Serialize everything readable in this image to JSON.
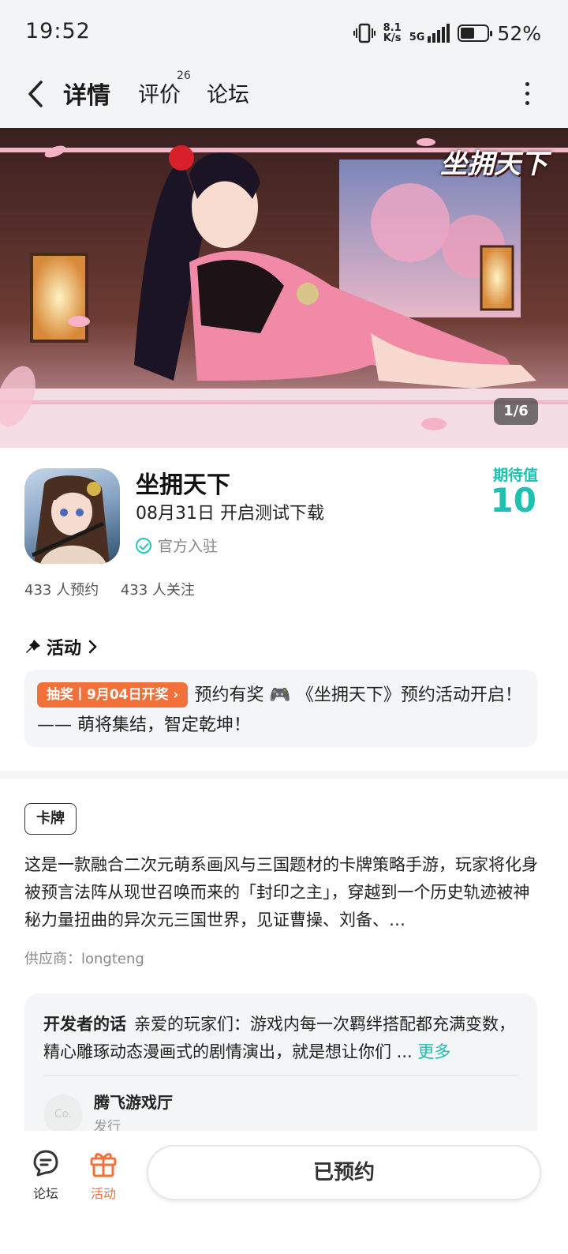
{
  "status_bar": {
    "time": "19:52",
    "net_speed_top": "8.1",
    "net_speed_bottom": "K/s",
    "network": "5G",
    "battery_percent": "52%",
    "battery_level": 0.52
  },
  "nav": {
    "tabs": [
      {
        "label": "详情",
        "active": true
      },
      {
        "label": "评价",
        "badge": "26"
      },
      {
        "label": "论坛"
      }
    ],
    "back_icon": "chevron-left-icon",
    "more_icon": "more-vertical-icon",
    "accent_color": "#25c7b9"
  },
  "banner": {
    "logo_text": "坐拥天下",
    "counter": "1/6"
  },
  "app": {
    "name": "坐拥天下",
    "release": "08月31日 开启测试下载",
    "official": "官方入驻",
    "expect_label": "期待值",
    "expect_value": "10",
    "reservations": "433 人预约",
    "follows": "433 人关注"
  },
  "activity": {
    "heading": "活动",
    "badge": "抽奖丨9月04日开奖",
    "text": "预约有奖 🎮 《坐拥天下》预约活动开启！—— 萌将集结，智定乾坤！"
  },
  "detail": {
    "tag": "卡牌",
    "description": "这是一款融合二次元萌系画风与三国题材的卡牌策略手游，玩家将化身被预言法阵从现世召唤而来的「封印之主」，穿越到一个历史轨迹被神秘力量扭曲的异次元三国世界，见证曹操、刘备、…",
    "supplier": "供应商：longteng"
  },
  "developer": {
    "title": "开发者的话",
    "text": "亲爱的玩家们：游戏内每一次羁绊搭配都充满变数，精心雕琢动态漫画式的剧情演出，就是想让你们 ...",
    "more": "更多",
    "avatar_text": "Co.",
    "publisher_name": "腾飞游戏厅",
    "publisher_role": "发行"
  },
  "bottom_bar": {
    "forum_label": "论坛",
    "activity_label": "活动",
    "reserve_label": "已预约",
    "activity_color": "#f2703a"
  }
}
